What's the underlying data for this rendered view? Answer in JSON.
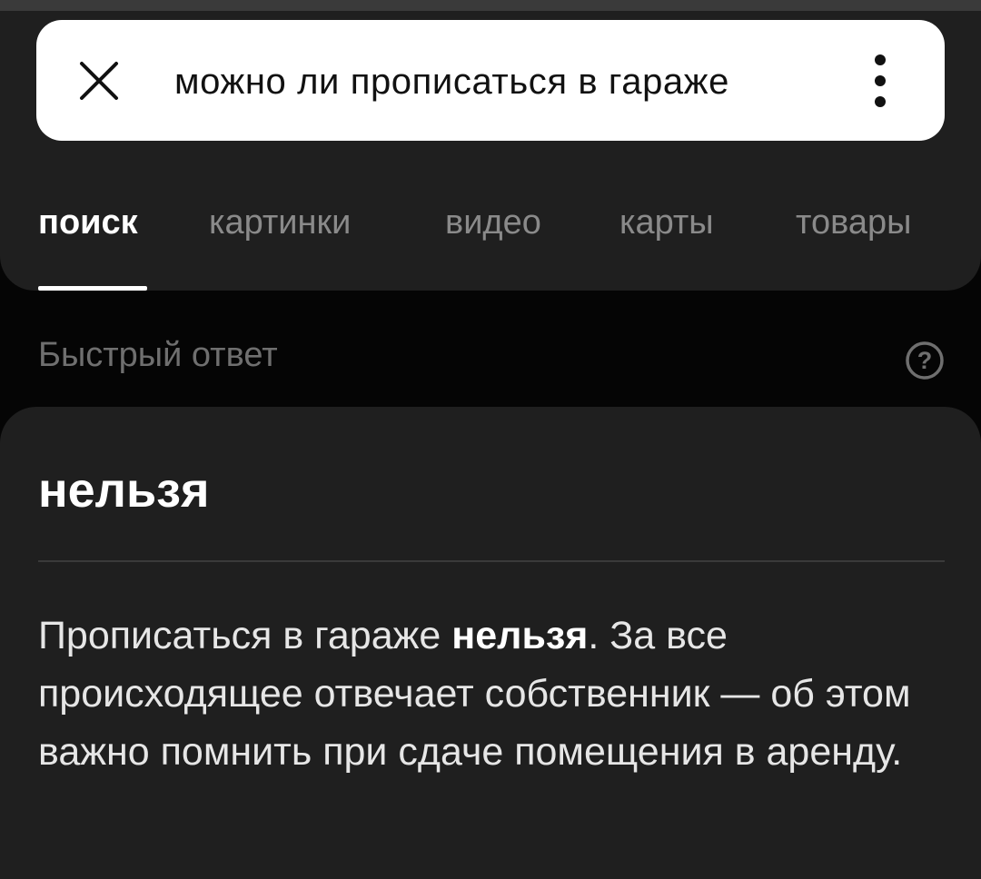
{
  "search": {
    "query": "можно ли прописаться в гараже",
    "close_icon": "close-icon",
    "menu_icon": "vertical-dots-icon"
  },
  "tabs": [
    {
      "label": "поиск",
      "active": true
    },
    {
      "label": "картинки",
      "active": false
    },
    {
      "label": "видео",
      "active": false
    },
    {
      "label": "карты",
      "active": false
    },
    {
      "label": "товары",
      "active": false
    }
  ],
  "quick_answer": {
    "section_label": "Быстрый ответ",
    "help_icon": "question-circle-icon",
    "title": "нельзя",
    "text_before": "Прописаться в гараже ",
    "text_bold": "нельзя",
    "text_after": ". За все происходящее отвечает собственник — об этом важно помнить при сдаче помещения в аренду."
  },
  "colors": {
    "background": "#050505",
    "panel": "#1f1f1f",
    "search_bar": "#ffffff",
    "active_tab": "#ffffff",
    "inactive_tab": "#8a8a8a",
    "section_label": "#6f6f6f"
  }
}
